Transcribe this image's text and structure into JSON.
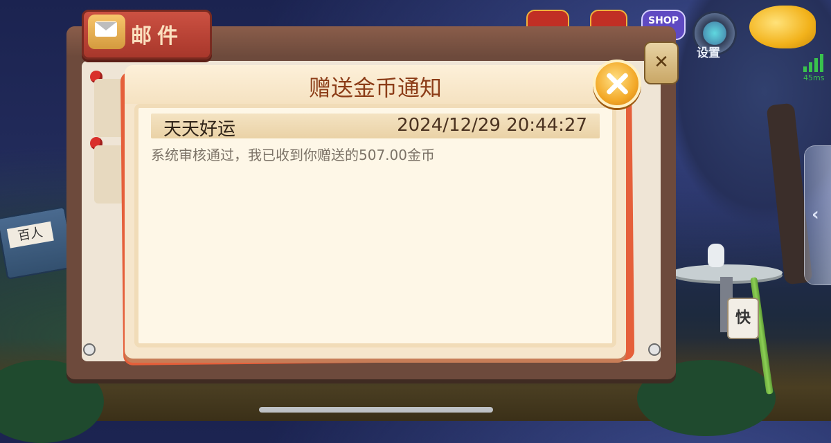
{
  "mailbox": {
    "title": "邮件"
  },
  "top_bar": {
    "shop_label": "SHOP",
    "settings_label": "设置",
    "ping": "45ms"
  },
  "board": {
    "close_glyph": "✕"
  },
  "dialog": {
    "title": "赠送金币通知",
    "mail": {
      "sender": "天天好运",
      "timestamp": "2024/12/29 20:44:27",
      "message": "系统审核通过，我已收到你赠送的507.00金币"
    }
  },
  "scene": {
    "book_label": "百人",
    "sign_label": "快"
  },
  "colors": {
    "title": "#8c3d18",
    "close_button": "#f3a928",
    "panel": "#f6e6cc"
  }
}
